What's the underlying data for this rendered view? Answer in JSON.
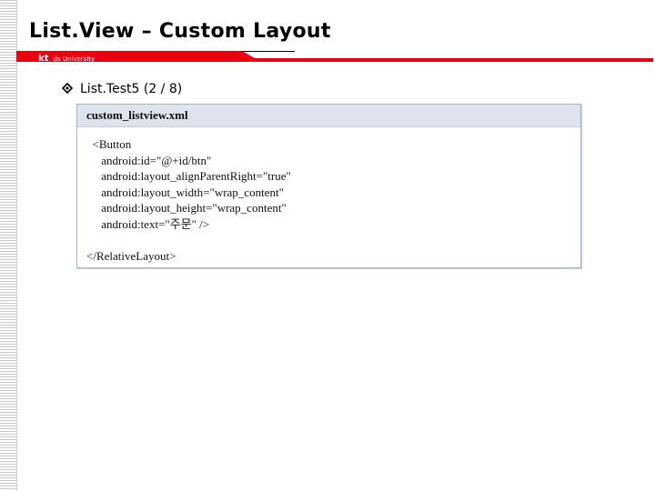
{
  "slide": {
    "title": "List.View – Custom Layout",
    "brand_kt": "kt",
    "brand_rest": "ds University",
    "bullet_text": "List.Test5 (2 / 8)",
    "colors": {
      "brand_red": "#e60012",
      "code_header_bg": "#dde4ee"
    }
  },
  "code": {
    "filename": "custom_listview.xml",
    "lines": [
      "  <Button",
      "     android:id=\"@+id/btn\"",
      "     android:layout_alignParentRight=\"true\"",
      "     android:layout_width=\"wrap_content\"",
      "     android:layout_height=\"wrap_content\"",
      "     android:text=\"주문\" />"
    ],
    "closing_line": "</RelativeLayout>"
  }
}
